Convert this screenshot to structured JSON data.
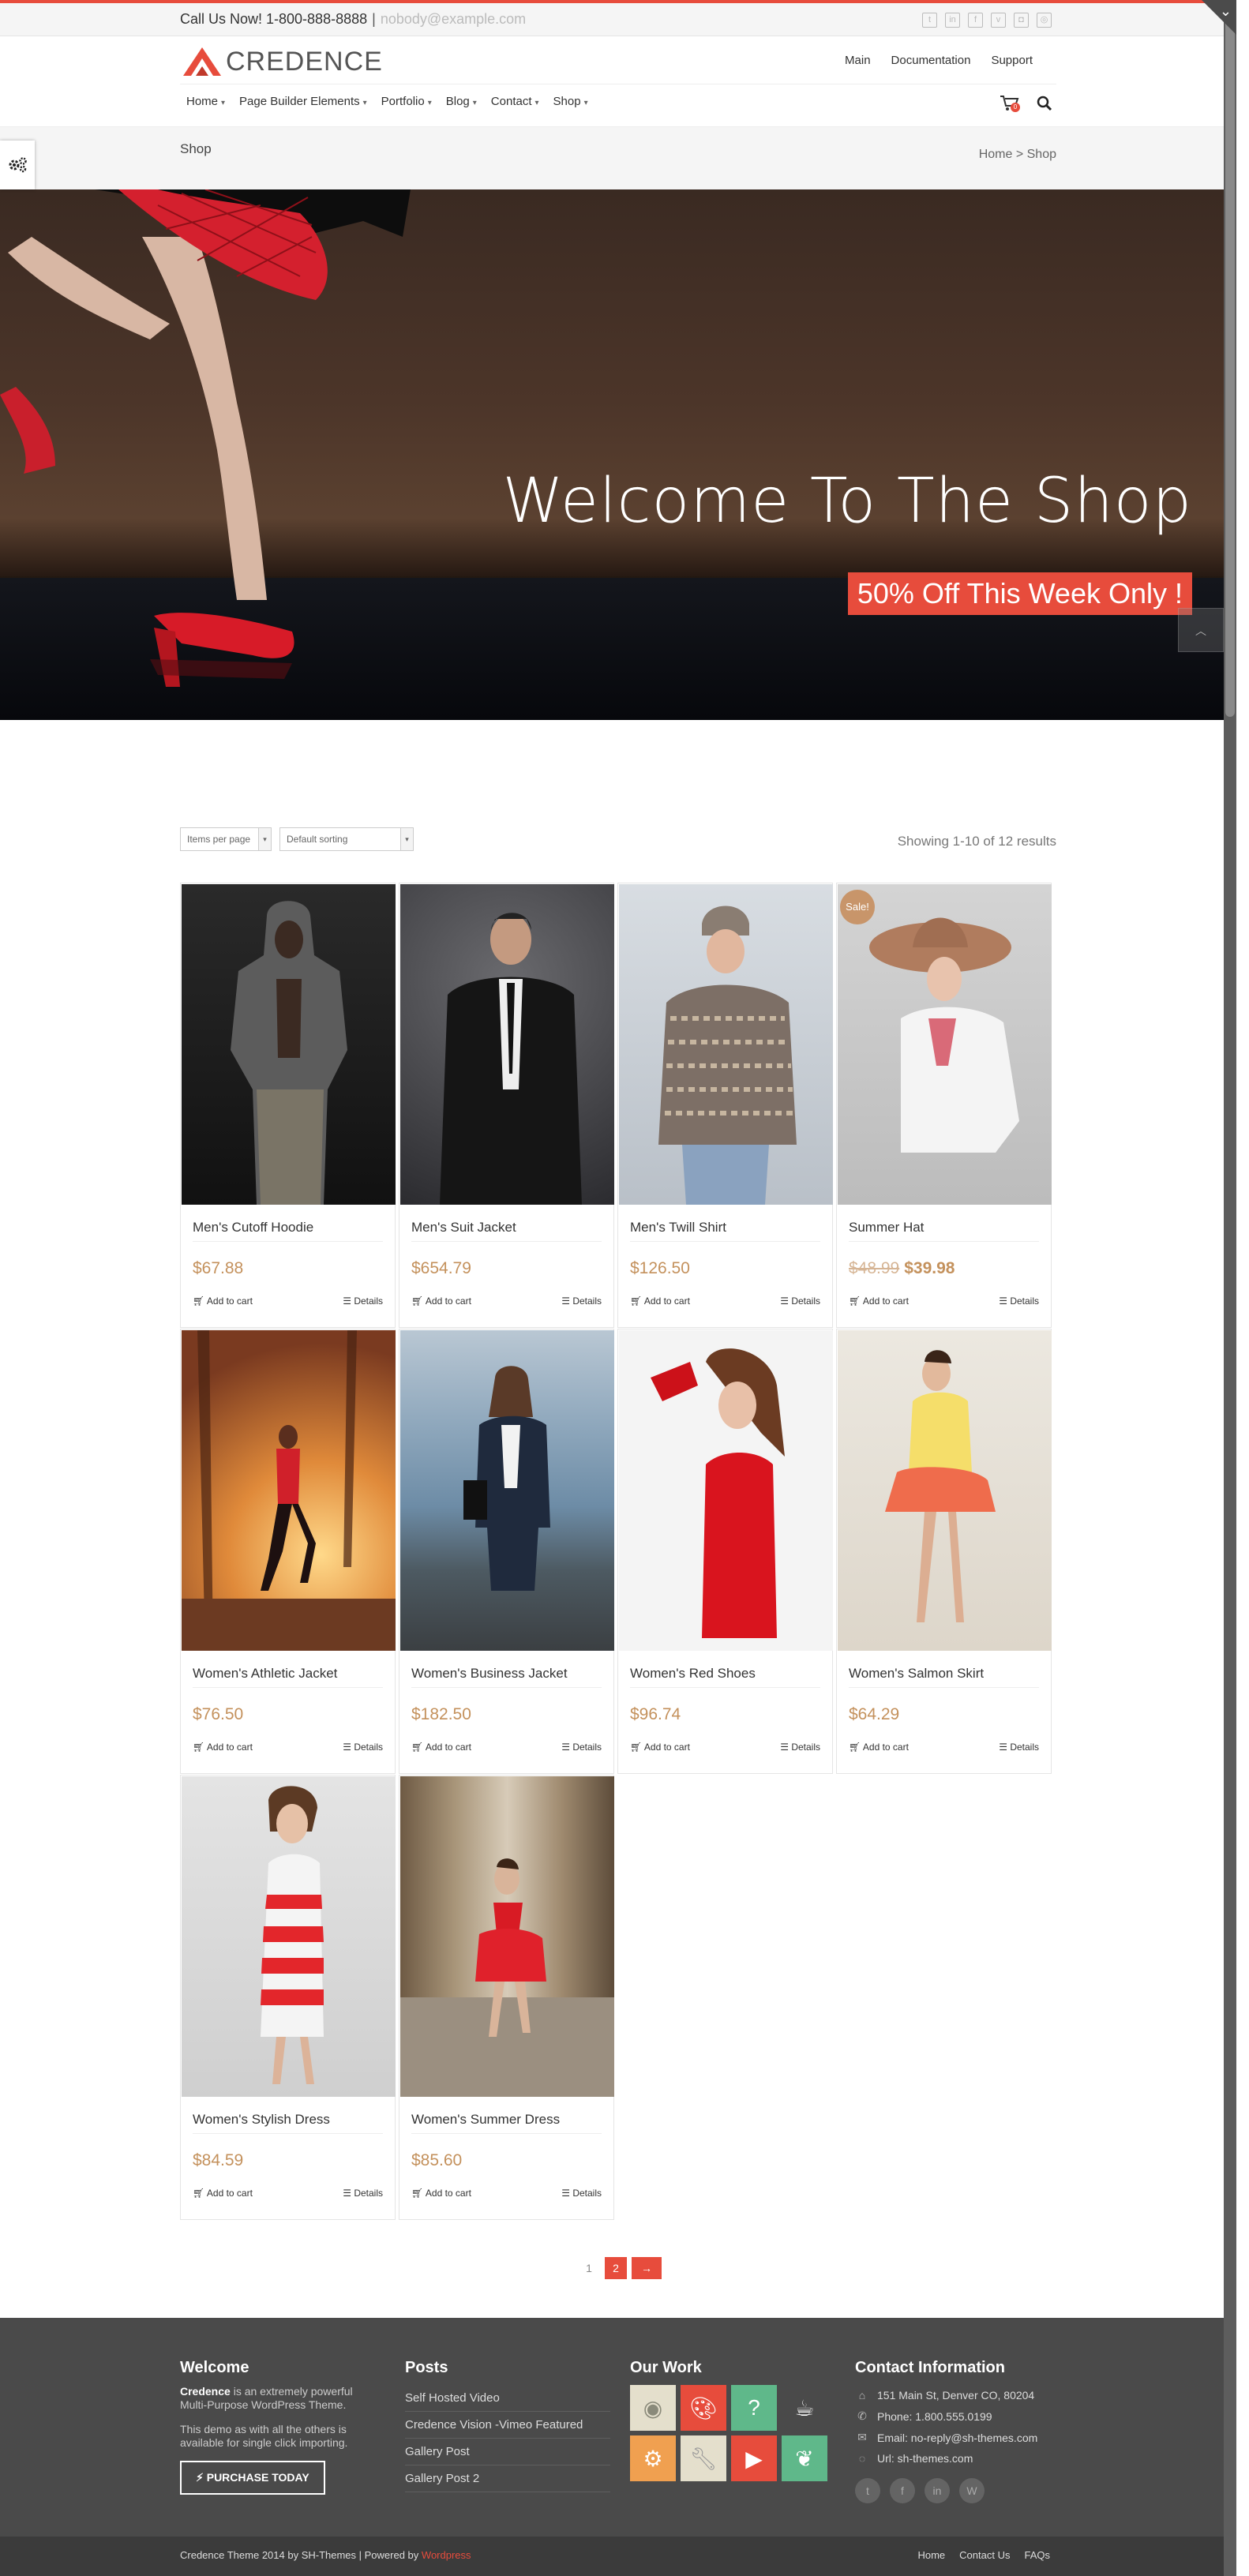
{
  "topbar": {
    "phone": "Call Us Now! 1-800-888-8888",
    "separator": "|",
    "email": "nobody@example.com",
    "social_icons": [
      "twitter-icon",
      "linkedin-icon",
      "facebook-icon",
      "vimeo-icon",
      "instagram-icon",
      "dribbble-icon"
    ]
  },
  "header": {
    "logo_text": "CREDENCE",
    "top_links": [
      "Main",
      "Documentation",
      "Support"
    ],
    "nav": [
      "Home",
      "Page Builder Elements",
      "Portfolio",
      "Blog",
      "Contact",
      "Shop"
    ],
    "cart_count": "0"
  },
  "titlebar": {
    "title": "Shop",
    "breadcrumb_home": "Home",
    "breadcrumb_sep": ">",
    "breadcrumb_current": "Shop"
  },
  "hero": {
    "heading": "Welcome To The Shop",
    "badge": "50% Off This Week Only !"
  },
  "controls": {
    "per_page": "Items per page",
    "sorting": "Default sorting",
    "result_count": "Showing 1-10 of 12 results"
  },
  "products": [
    {
      "name": "Men's Cutoff Hoodie",
      "price": "$67.88",
      "sale": false
    },
    {
      "name": "Men's Suit Jacket",
      "price": "$654.79",
      "sale": false
    },
    {
      "name": "Men's Twill Shirt",
      "price": "$126.50",
      "sale": false
    },
    {
      "name": "Summer Hat",
      "old_price": "$48.99",
      "price": "$39.98",
      "sale": true
    },
    {
      "name": "Women's Athletic Jacket",
      "price": "$76.50",
      "sale": false
    },
    {
      "name": "Women's Business Jacket",
      "price": "$182.50",
      "sale": false
    },
    {
      "name": "Women's Red Shoes",
      "price": "$96.74",
      "sale": false
    },
    {
      "name": "Women's Salmon Skirt",
      "price": "$64.29",
      "sale": false
    },
    {
      "name": "Women's Stylish Dress",
      "price": "$84.59",
      "sale": false
    },
    {
      "name": "Women's Summer Dress",
      "price": "$85.60",
      "sale": false
    }
  ],
  "product_actions": {
    "add_to_cart": "Add to cart",
    "details": "Details",
    "sale_tag": "Sale!"
  },
  "pagination": {
    "pages": [
      "1",
      "2"
    ],
    "current": "2",
    "next": "→"
  },
  "footer": {
    "welcome_title": "Welcome",
    "welcome_brand": "Credence",
    "welcome_text_1": " is an extremely powerful Multi-Purpose WordPress Theme.",
    "welcome_text_2": "This demo as with all the others is available for single click importing.",
    "purchase_label": "PURCHASE TODAY",
    "posts_title": "Posts",
    "posts": [
      "Self Hosted Video",
      "Credence Vision -Vimeo Featured",
      "Gallery Post",
      "Gallery Post 2"
    ],
    "work_title": "Our Work",
    "contact_title": "Contact Information",
    "address": "151 Main St, Denver CO, 80204",
    "phone": "Phone: 1.800.555.0199",
    "email": "Email: no-reply@sh-themes.com",
    "url": "Url: sh-themes.com",
    "social": [
      "twitter-icon",
      "facebook-icon",
      "linkedin-icon",
      "wordpress-icon"
    ]
  },
  "bottom": {
    "copyright": "Credence Theme 2014 by SH-Themes | Powered by",
    "powered": "Wordpress",
    "links": [
      "Home",
      "Contact Us",
      "FAQs"
    ]
  },
  "colors": {
    "accent": "#e74c3c",
    "price": "#c4915c",
    "footer_bg": "#4a4a4a"
  }
}
